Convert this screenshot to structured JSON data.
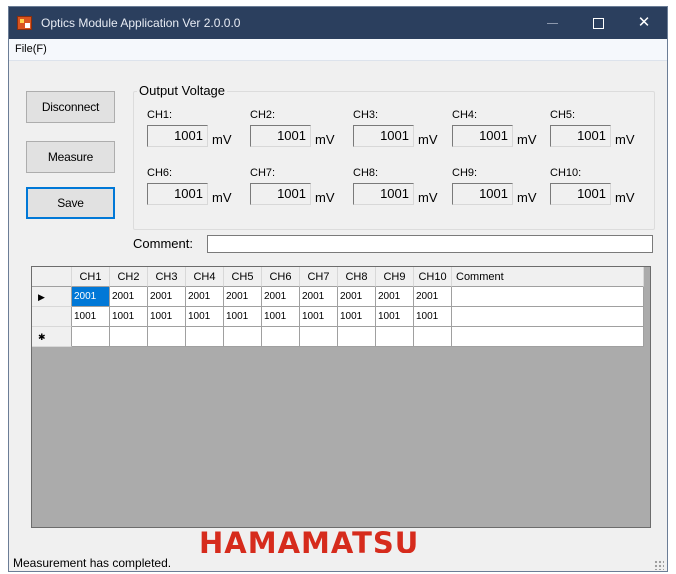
{
  "window": {
    "title": "Optics Module Application Ver 2.0.0.0",
    "app_icon": "app-icon",
    "min_icon": "minimize-icon",
    "max_icon": "maximize-icon",
    "close_glyph": "✕"
  },
  "menu": {
    "file": "File(F)"
  },
  "buttons": {
    "disconnect": "Disconnect",
    "measure": "Measure",
    "save": "Save"
  },
  "output_voltage": {
    "title": "Output Voltage",
    "unit": "mV",
    "channels": [
      {
        "label": "CH1:",
        "value": "1001"
      },
      {
        "label": "CH2:",
        "value": "1001"
      },
      {
        "label": "CH3:",
        "value": "1001"
      },
      {
        "label": "CH4:",
        "value": "1001"
      },
      {
        "label": "CH5:",
        "value": "1001"
      },
      {
        "label": "CH6:",
        "value": "1001"
      },
      {
        "label": "CH7:",
        "value": "1001"
      },
      {
        "label": "CH8:",
        "value": "1001"
      },
      {
        "label": "CH9:",
        "value": "1001"
      },
      {
        "label": "CH10:",
        "value": "1001"
      }
    ]
  },
  "comment": {
    "label": "Comment:",
    "value": ""
  },
  "grid": {
    "columns": [
      "CH1",
      "CH2",
      "CH3",
      "CH4",
      "CH5",
      "CH6",
      "CH7",
      "CH8",
      "CH9",
      "CH10",
      "Comment"
    ],
    "current_row_glyph": "▶",
    "new_row_glyph": "✱",
    "rows": [
      [
        "2001",
        "2001",
        "2001",
        "2001",
        "2001",
        "2001",
        "2001",
        "2001",
        "2001",
        "2001",
        ""
      ],
      [
        "1001",
        "1001",
        "1001",
        "1001",
        "1001",
        "1001",
        "1001",
        "1001",
        "1001",
        "1001",
        ""
      ],
      [
        "",
        "",
        "",
        "",
        "",
        "",
        "",
        "",
        "",
        "",
        ""
      ]
    ]
  },
  "logo": {
    "text": "HAMAMATSU",
    "color": "#d62b1c"
  },
  "status": {
    "text": "Measurement has completed."
  },
  "colors": {
    "titlebar": "#2b3f5e",
    "selection": "#0078d7",
    "default_button_border": "#0078d7"
  }
}
